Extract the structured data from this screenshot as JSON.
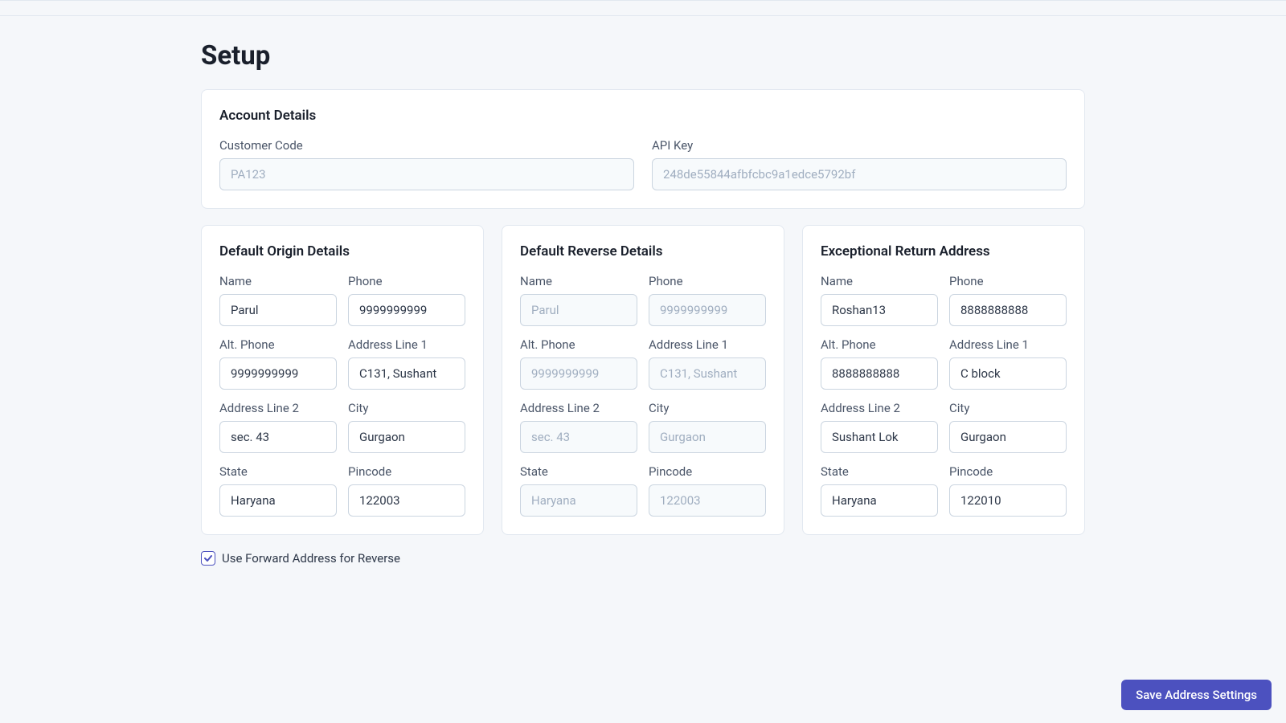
{
  "page": {
    "title": "Setup"
  },
  "account": {
    "section_title": "Account Details",
    "customer_code_label": "Customer Code",
    "customer_code_value": "PA123",
    "api_key_label": "API Key",
    "api_key_value": "248de55844afbfcbc9a1edce5792bf"
  },
  "labels": {
    "name": "Name",
    "phone": "Phone",
    "alt_phone": "Alt. Phone",
    "address_line_1": "Address Line 1",
    "address_line_2": "Address Line 2",
    "city": "City",
    "state": "State",
    "pincode": "Pincode"
  },
  "origin": {
    "section_title": "Default Origin Details",
    "name": "Parul",
    "phone": "9999999999",
    "alt_phone": "9999999999",
    "address_line_1": "C131, Sushant",
    "address_line_2": "sec. 43",
    "city": "Gurgaon",
    "state": "Haryana",
    "pincode": "122003"
  },
  "reverse": {
    "section_title": "Default Reverse Details",
    "name": "Parul",
    "phone": "9999999999",
    "alt_phone": "9999999999",
    "address_line_1": "C131, Sushant",
    "address_line_2": "sec. 43",
    "city": "Gurgaon",
    "state": "Haryana",
    "pincode": "122003"
  },
  "exceptional": {
    "section_title": "Exceptional Return Address",
    "name": "Roshan13",
    "phone": "8888888888",
    "alt_phone": "8888888888",
    "address_line_1": "C block",
    "address_line_2": "Sushant Lok",
    "city": "Gurgaon",
    "state": "Haryana",
    "pincode": "122010"
  },
  "checkbox": {
    "label": "Use Forward Address for Reverse",
    "checked": true
  },
  "buttons": {
    "save": "Save Address Settings"
  }
}
